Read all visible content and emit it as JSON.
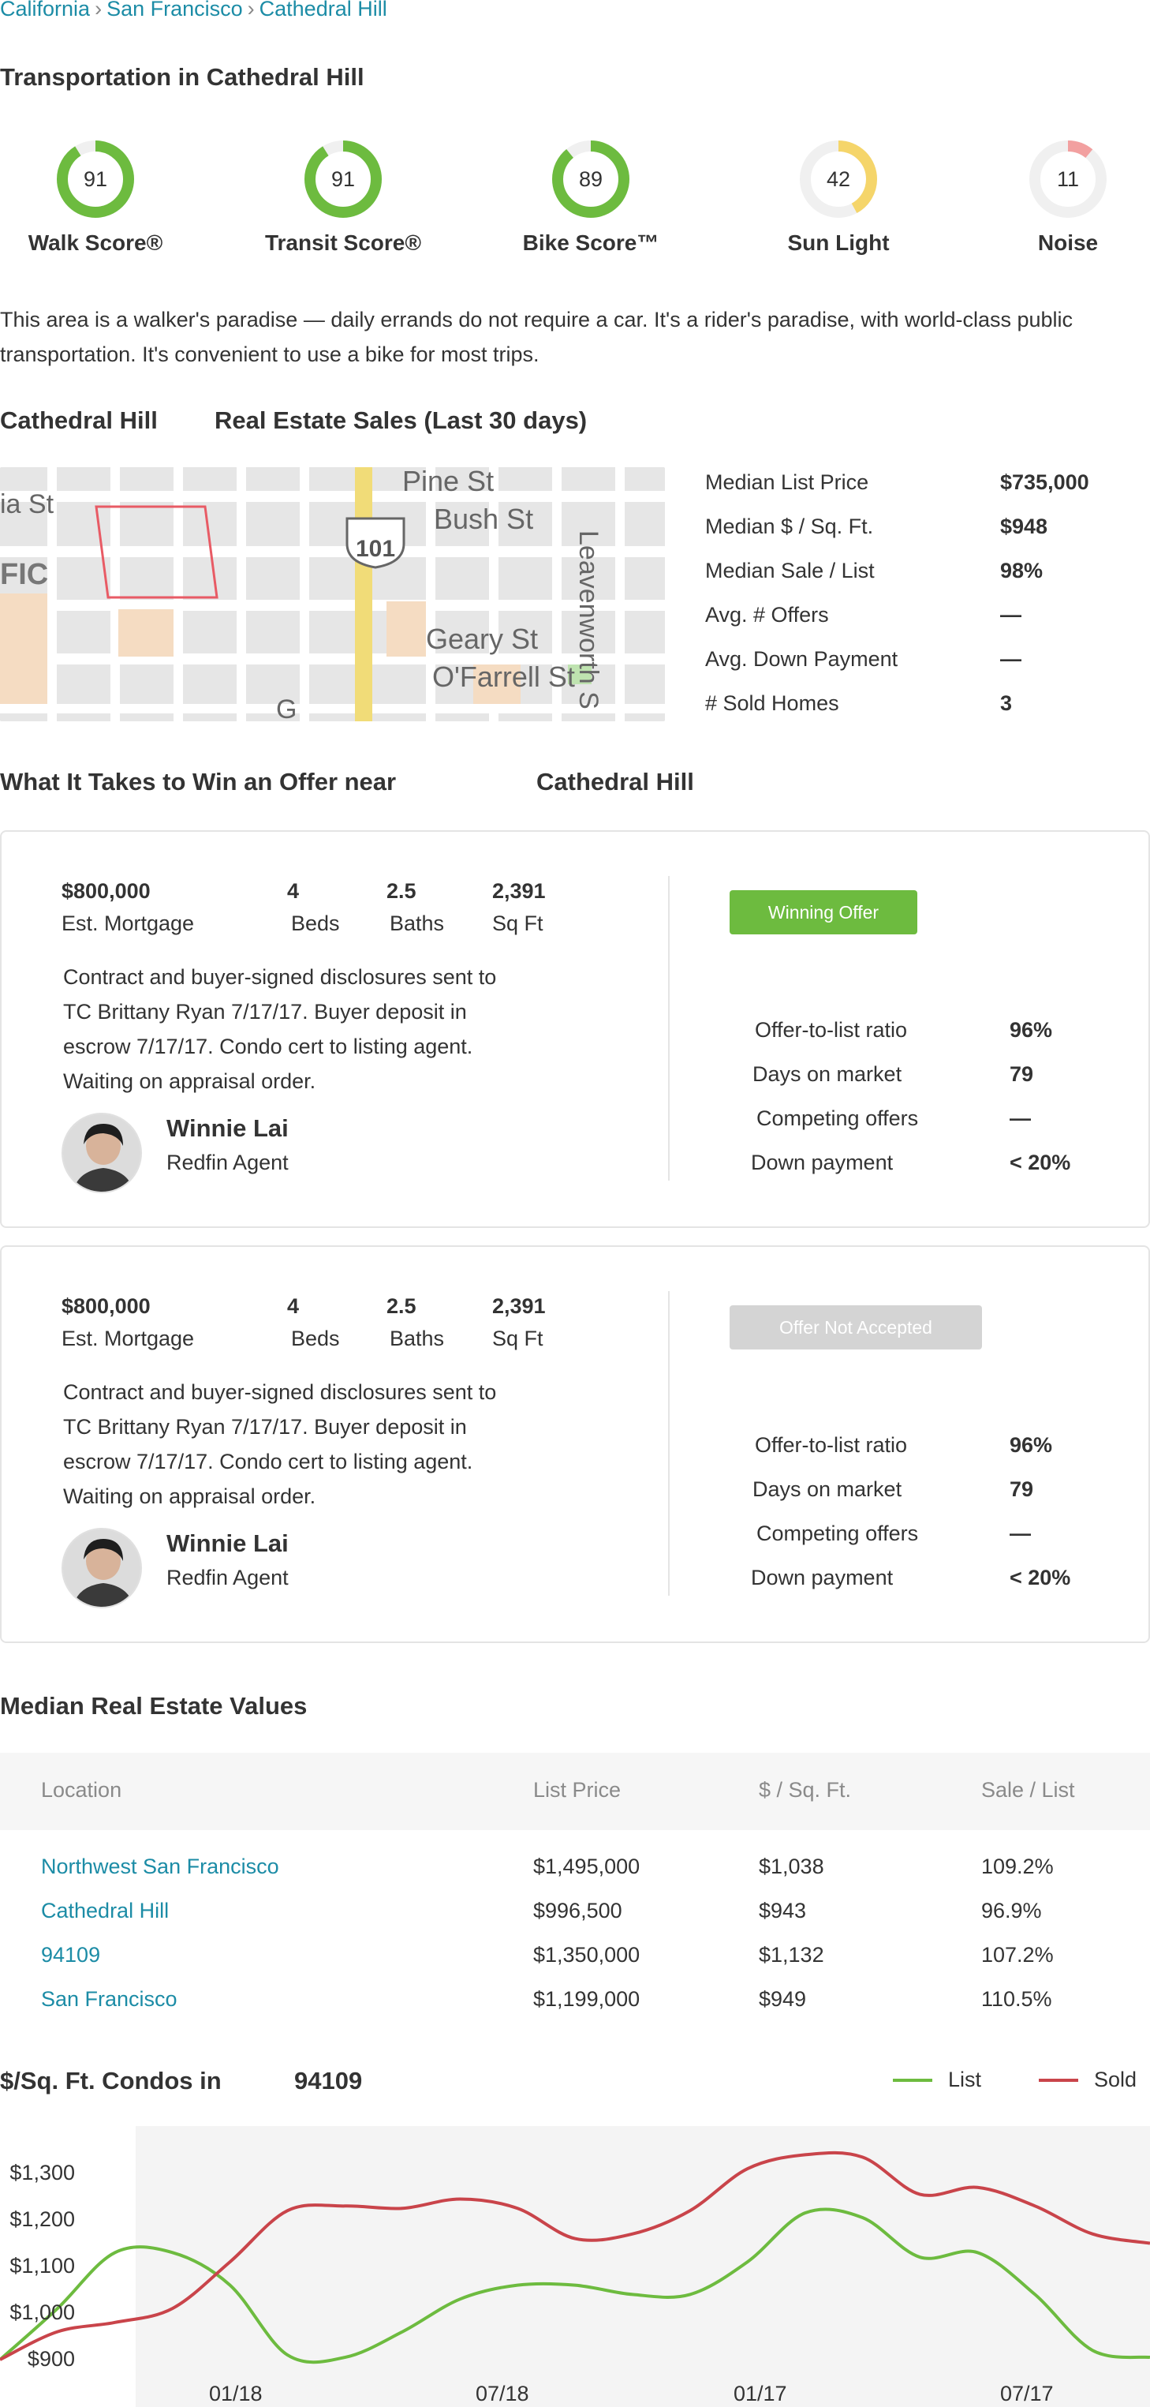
{
  "breadcrumb": [
    "California",
    "San Francisco",
    "Cathedral Hill"
  ],
  "transportation": {
    "title": "Transportation in Cathedral Hill",
    "scores": [
      {
        "label": "Walk Score®",
        "value": "91",
        "fraction": 0.91,
        "color": "#6dbb3f"
      },
      {
        "label": "Transit Score®",
        "value": "91",
        "fraction": 0.91,
        "color": "#6dbb3f"
      },
      {
        "label": "Bike Score™",
        "value": "89",
        "fraction": 0.89,
        "color": "#6dbb3f"
      },
      {
        "label": "Sun Light",
        "value": "42",
        "fraction": 0.42,
        "color": "#f5d56a"
      },
      {
        "label": "Noise",
        "value": "11",
        "fraction": 0.11,
        "color": "#f2a0a0"
      }
    ],
    "description": "This area is a walker's paradise — daily errands do not require a car. It's a rider's paradise, with world-class public transportation. It's convenient to use a bike for most trips."
  },
  "sales": {
    "neighborhood": "Cathedral Hill",
    "title": "Real Estate Sales (Last 30 days)",
    "map_labels": {
      "street1": "ia St",
      "street2": "Pine St",
      "street3": "Bush St",
      "street4": "Geary St",
      "street5": "O'Farrell St",
      "street6": "Leavenworth S",
      "street7": "G",
      "area": "FIC",
      "highway": "101"
    },
    "stats": [
      {
        "label": "Median List Price",
        "value": "$735,000"
      },
      {
        "label": "Median $ / Sq. Ft.",
        "value": "$948"
      },
      {
        "label": "Median Sale / List",
        "value": "98%"
      },
      {
        "label": "Avg. # Offers",
        "value": "—"
      },
      {
        "label": "Avg. Down Payment",
        "value": "—"
      },
      {
        "label": "# Sold Homes",
        "value": "3"
      }
    ]
  },
  "offers": {
    "title": "What It Takes to Win an Offer near",
    "neighborhood": "Cathedral Hill",
    "cards": [
      {
        "price": "$800,000",
        "price_label": "Est. Mortgage",
        "beds": "4",
        "beds_label": "Beds",
        "baths": "2.5",
        "baths_label": "Baths",
        "sqft": "2,391",
        "sqft_label": "Sq Ft",
        "note": "Contract and buyer-signed disclosures sent to TC Brittany Ryan 7/17/17. Buyer deposit in escrow 7/17/17. Condo cert to listing agent. Waiting on appraisal order.",
        "agent_name": "Winnie Lai",
        "agent_role": "Redfin Agent",
        "badge": "Winning Offer",
        "badge_color": "#6dbb3f",
        "details": [
          {
            "label": "Offer-to-list ratio",
            "value": "96%"
          },
          {
            "label": "Days on market",
            "value": "79"
          },
          {
            "label": "Competing offers",
            "value": "—"
          },
          {
            "label": "Down payment",
            "value": "< 20%"
          }
        ]
      },
      {
        "price": "$800,000",
        "price_label": "Est. Mortgage",
        "beds": "4",
        "beds_label": "Beds",
        "baths": "2.5",
        "baths_label": "Baths",
        "sqft": "2,391",
        "sqft_label": "Sq Ft",
        "note": "Contract and buyer-signed disclosures sent to TC Brittany Ryan 7/17/17. Buyer deposit in escrow 7/17/17. Condo cert to listing agent. Waiting on appraisal order.",
        "agent_name": "Winnie Lai",
        "agent_role": "Redfin Agent",
        "badge": "Offer Not Accepted",
        "badge_color": "#d4d4d4",
        "details": [
          {
            "label": "Offer-to-list ratio",
            "value": "96%"
          },
          {
            "label": "Days on market",
            "value": "79"
          },
          {
            "label": "Competing offers",
            "value": "—"
          },
          {
            "label": "Down payment",
            "value": "< 20%"
          }
        ]
      }
    ]
  },
  "median_values": {
    "title": "Median Real Estate Values",
    "columns": [
      "Location",
      "List Price",
      "$ / Sq. Ft.",
      "Sale / List"
    ],
    "rows": [
      [
        "Northwest San Francisco",
        "$1,495,000",
        "$1,038",
        "109.2%"
      ],
      [
        "Cathedral Hill",
        "$996,500",
        "$943",
        "96.9%"
      ],
      [
        "94109",
        "$1,350,000",
        "$1,132",
        "107.2%"
      ],
      [
        "San Francisco",
        "$1,199,000",
        "$949",
        "110.5%"
      ]
    ]
  },
  "chart": {
    "title": "$/Sq. Ft. Condos in",
    "zip": "94109",
    "legend_list": "List",
    "legend_sold": "Sold",
    "list_color": "#6dbb3f",
    "sold_color": "#c9444a"
  },
  "chart_data": {
    "type": "line",
    "title": "$/Sq. Ft. Condos in 94109",
    "xlabel": "",
    "ylabel": "",
    "ylim": [
      900,
      1300
    ],
    "yticks": [
      "$1,300",
      "$1,200",
      "$1,100",
      "$1,000",
      "$900"
    ],
    "xticks": [
      "01/18",
      "07/18",
      "01/17",
      "07/17"
    ],
    "series": [
      {
        "name": "List",
        "x": [
          0,
          0.05,
          0.1,
          0.15,
          0.2,
          0.25,
          0.3,
          0.35,
          0.4,
          0.45,
          0.5,
          0.55,
          0.6,
          0.65,
          0.7,
          0.75,
          0.8,
          0.85,
          0.9,
          0.95,
          1.0
        ],
        "values": [
          900,
          1010,
          1130,
          1130,
          1060,
          910,
          905,
          960,
          1030,
          1060,
          1060,
          1040,
          1040,
          1110,
          1215,
          1205,
          1120,
          1130,
          1040,
          920,
          905
        ]
      },
      {
        "name": "Sold",
        "x": [
          0,
          0.05,
          0.1,
          0.15,
          0.2,
          0.25,
          0.3,
          0.35,
          0.4,
          0.45,
          0.5,
          0.55,
          0.6,
          0.65,
          0.7,
          0.75,
          0.8,
          0.85,
          0.9,
          0.95,
          1.0
        ],
        "values": [
          900,
          960,
          980,
          1010,
          1110,
          1220,
          1230,
          1225,
          1245,
          1225,
          1160,
          1170,
          1220,
          1310,
          1340,
          1335,
          1255,
          1270,
          1230,
          1170,
          1150
        ]
      }
    ]
  }
}
